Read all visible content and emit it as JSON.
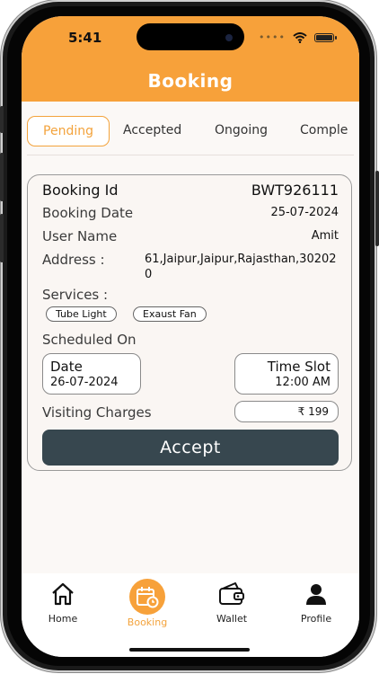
{
  "status_bar": {
    "time": "5:41"
  },
  "header": {
    "title": "Booking"
  },
  "tabs": [
    {
      "label": "Pending",
      "active": true
    },
    {
      "label": "Accepted",
      "active": false
    },
    {
      "label": "Ongoing",
      "active": false
    },
    {
      "label": "Comple",
      "active": false
    }
  ],
  "booking": {
    "booking_id_label": "Booking Id",
    "booking_id": "BWT926111",
    "booking_date_label": "Booking Date",
    "booking_date": "25-07-2024",
    "user_name_label": "User Name",
    "user_name": "Amit",
    "address_label": "Address :",
    "address": "61,Jaipur,Jaipur,Rajasthan,302020",
    "services_label": "Services :",
    "services": [
      "Tube Light",
      "Exaust Fan"
    ],
    "scheduled_label": "Scheduled On",
    "date_label": "Date",
    "date_value": "26-07-2024",
    "time_slot_label": "Time Slot",
    "time_slot_value": "12:00 AM",
    "visiting_label": "Visiting Charges",
    "visiting_value": "₹ 199",
    "accept_label": "Accept"
  },
  "nav": [
    {
      "label": "Home",
      "icon": "home-icon",
      "active": false
    },
    {
      "label": "Booking",
      "icon": "calendar-icon",
      "active": true
    },
    {
      "label": "Wallet",
      "icon": "wallet-icon",
      "active": false
    },
    {
      "label": "Profile",
      "icon": "person-icon",
      "active": false
    }
  ],
  "colors": {
    "accent": "#f7a13a",
    "button": "#37474f"
  }
}
